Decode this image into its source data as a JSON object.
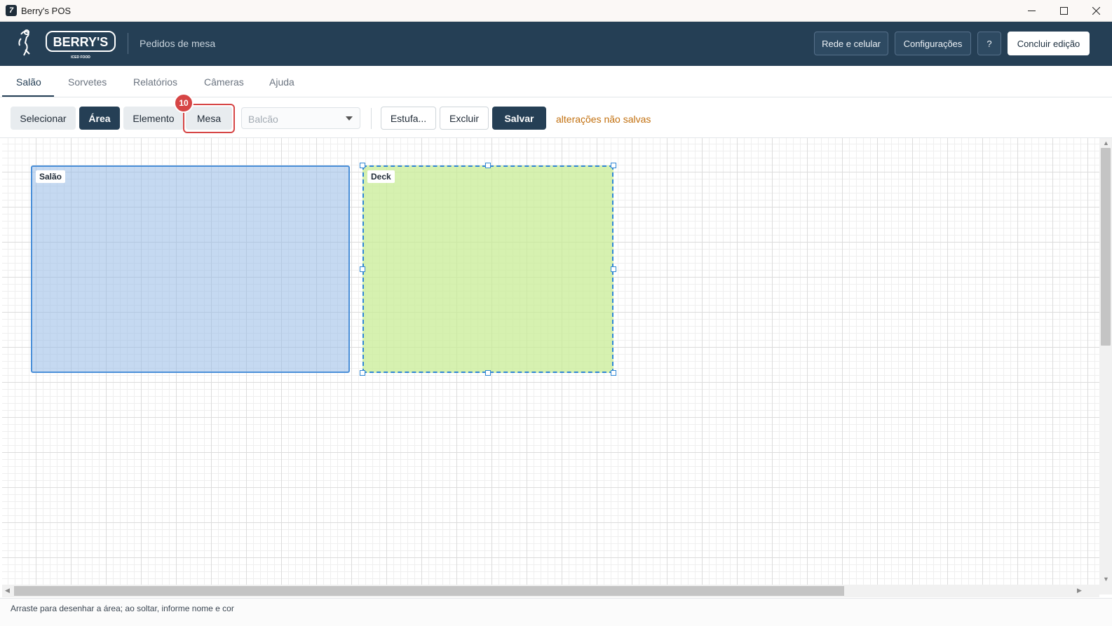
{
  "window": {
    "title": "Berry's POS",
    "app_icon_glyph": "7"
  },
  "header": {
    "logo_text": "BERRY'S",
    "logo_subtext": "ICED FOOD",
    "title": "Pedidos de mesa",
    "buttons": {
      "network": "Rede e celular",
      "settings": "Configurações",
      "help": "?",
      "finish": "Concluir edição"
    }
  },
  "tabs": [
    {
      "label": "Salão",
      "active": true
    },
    {
      "label": "Sorvetes",
      "active": false
    },
    {
      "label": "Relatórios",
      "active": false
    },
    {
      "label": "Câmeras",
      "active": false
    },
    {
      "label": "Ajuda",
      "active": false
    }
  ],
  "toolbar": {
    "select": "Selecionar",
    "area": "Área",
    "element": "Elemento",
    "table": "Mesa",
    "badge": "10",
    "dropdown_value": "Balcão",
    "stove": "Estufa...",
    "delete": "Excluir",
    "save": "Salvar",
    "unsaved_notice": "alterações não salvas"
  },
  "canvas": {
    "areas": [
      {
        "name": "Salão",
        "color": "#96bae6",
        "selected": false
      },
      {
        "name": "Deck",
        "color": "#c8ec96",
        "selected": true
      }
    ]
  },
  "status": {
    "hint": "Arraste para desenhar a área; ao soltar, informe nome e cor"
  },
  "colors": {
    "header_bg": "#253f55",
    "accent": "#253f55",
    "highlight": "#d64545",
    "warning_text": "#c2700f"
  }
}
